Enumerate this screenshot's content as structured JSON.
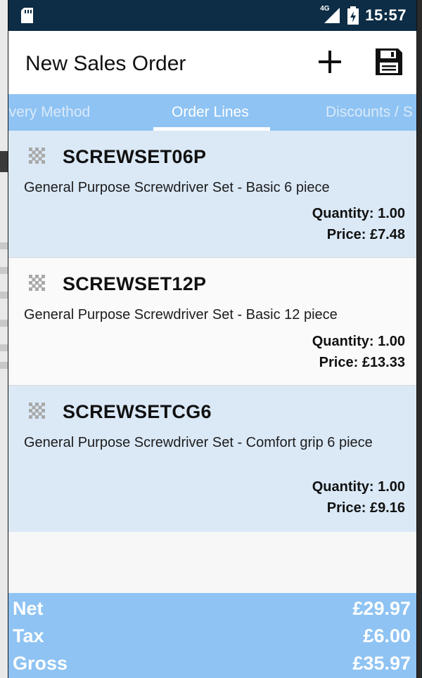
{
  "status_bar": {
    "network_label": "4G",
    "time": "15:57"
  },
  "app_bar": {
    "title": "New Sales Order",
    "actions": [
      "add-icon",
      "save-icon"
    ]
  },
  "tabs": [
    {
      "label": "Delivery Method",
      "visible_text": "ivery Method",
      "active": false
    },
    {
      "label": "Order Lines",
      "visible_text": "Order Lines",
      "active": true
    },
    {
      "label": "Discounts / S",
      "visible_text": "Discounts / S",
      "active": false
    }
  ],
  "order_lines": [
    {
      "code": "SCREWSET06P",
      "description": "General Purpose Screwdriver Set - Basic 6 piece",
      "quantity": "Quantity: 1.00",
      "price": "Price: £7.48"
    },
    {
      "code": "SCREWSET12P",
      "description": "General Purpose Screwdriver Set - Basic 12 piece",
      "quantity": "Quantity: 1.00",
      "price": "Price: £13.33"
    },
    {
      "code": "SCREWSETCG6",
      "description": "General Purpose Screwdriver Set - Comfort grip 6 piece",
      "quantity": "Quantity: 1.00",
      "price": "Price: £9.16"
    }
  ],
  "totals": {
    "net_label": "Net",
    "net_value": "£29.97",
    "tax_label": "Tax",
    "tax_value": "£6.00",
    "gross_label": "Gross",
    "gross_value": "£35.97"
  },
  "colors": {
    "status_bar": "#0d2c45",
    "accent": "#8ec3f3",
    "row_shaded": "#dbe9f7"
  }
}
